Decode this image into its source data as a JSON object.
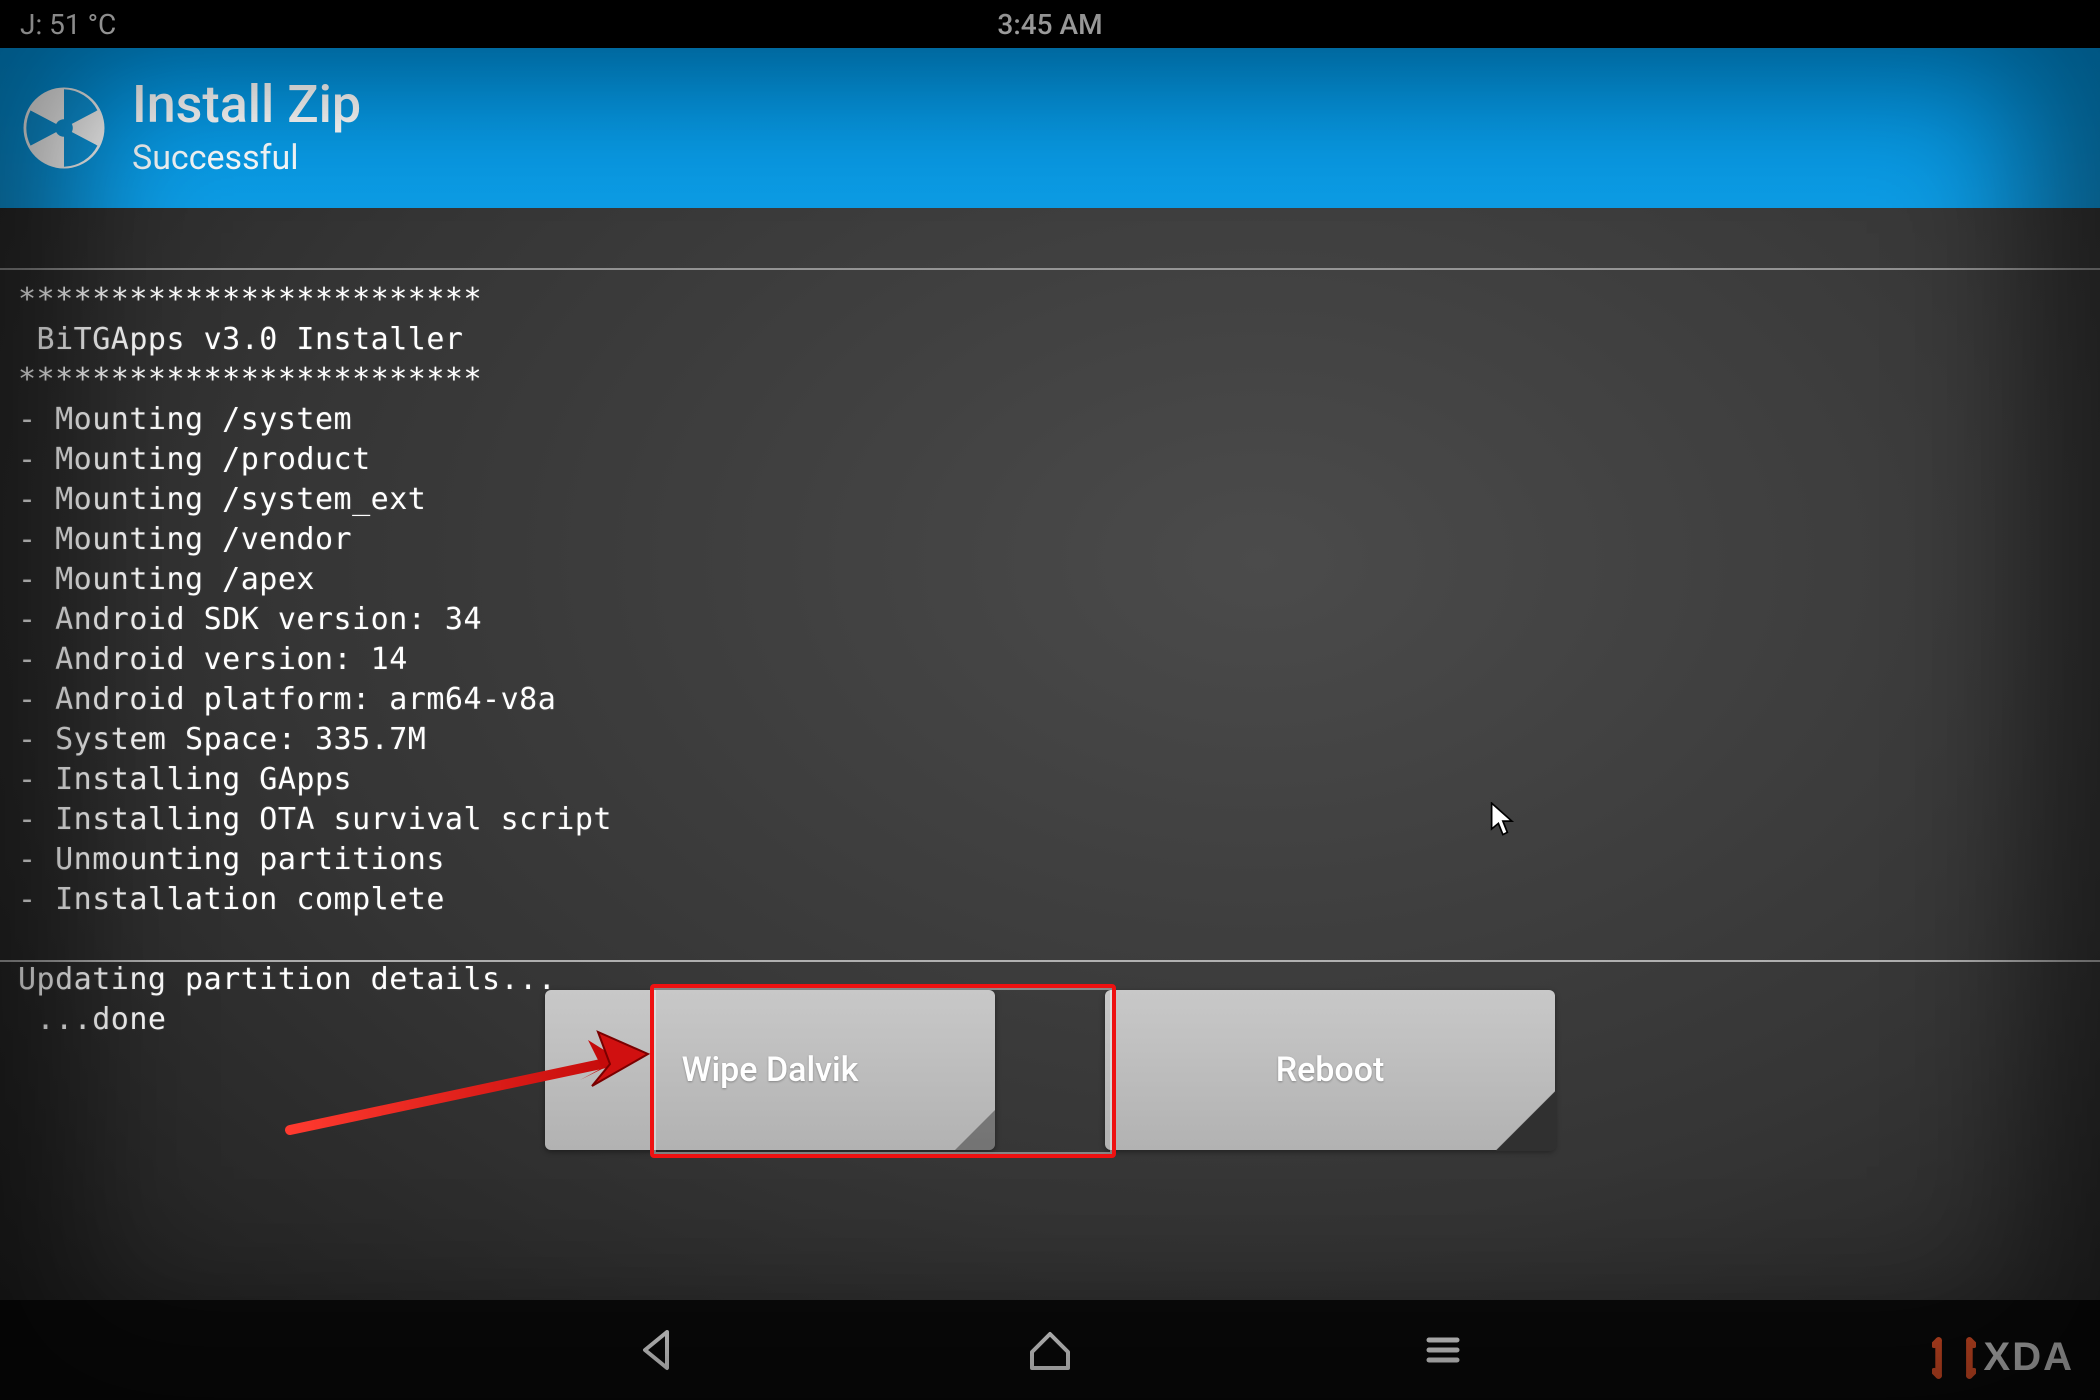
{
  "status": {
    "temp_label": "J: 51 °C",
    "time": "3:45 AM"
  },
  "header": {
    "title": "Install Zip",
    "subtitle": "Successful"
  },
  "console": {
    "lines": [
      "*************************",
      " BiTGApps v3.0 Installer",
      "*************************",
      "- Mounting /system",
      "- Mounting /product",
      "- Mounting /system_ext",
      "- Mounting /vendor",
      "- Mounting /apex",
      "- Android SDK version: 34",
      "- Android version: 14",
      "- Android platform: arm64-v8a",
      "- System Space: 335.7M",
      "- Installing GApps",
      "- Installing OTA survival script",
      "- Unmounting partitions",
      "- Installation complete",
      "",
      "Updating partition details...",
      " ...done"
    ]
  },
  "buttons": {
    "wipe_dalvik": "Wipe Dalvik",
    "reboot": "Reboot"
  },
  "annotation": {
    "highlighted_button": "wipe_dalvik"
  },
  "nav": {
    "back": "back-icon",
    "home": "home-icon",
    "menu": "menu-icon"
  },
  "watermark": {
    "text": "XDA"
  }
}
